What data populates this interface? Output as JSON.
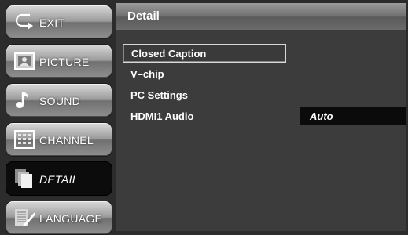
{
  "sidebar": {
    "items": [
      {
        "label": "EXIT",
        "icon": "exit-return-icon"
      },
      {
        "label": "PICTURE",
        "icon": "picture-icon"
      },
      {
        "label": "SOUND",
        "icon": "music-note-icon"
      },
      {
        "label": "CHANNEL",
        "icon": "channel-grid-icon"
      },
      {
        "label": "DETAIL",
        "icon": "detail-pages-icon",
        "active": true
      },
      {
        "label": "LANGUAGE",
        "icon": "language-icon"
      }
    ]
  },
  "panel": {
    "title": "Detail",
    "items": [
      {
        "label": "Closed Caption",
        "selected": true
      },
      {
        "label": "V–chip"
      },
      {
        "label": "PC Settings"
      },
      {
        "label": "HDMI1 Audio",
        "value": "Auto"
      }
    ]
  },
  "colors": {
    "background": "#2c2c2c",
    "panel": "#3c3c3c",
    "active_tab": "#0c0c0c",
    "value_box": "#0b0b0b"
  }
}
